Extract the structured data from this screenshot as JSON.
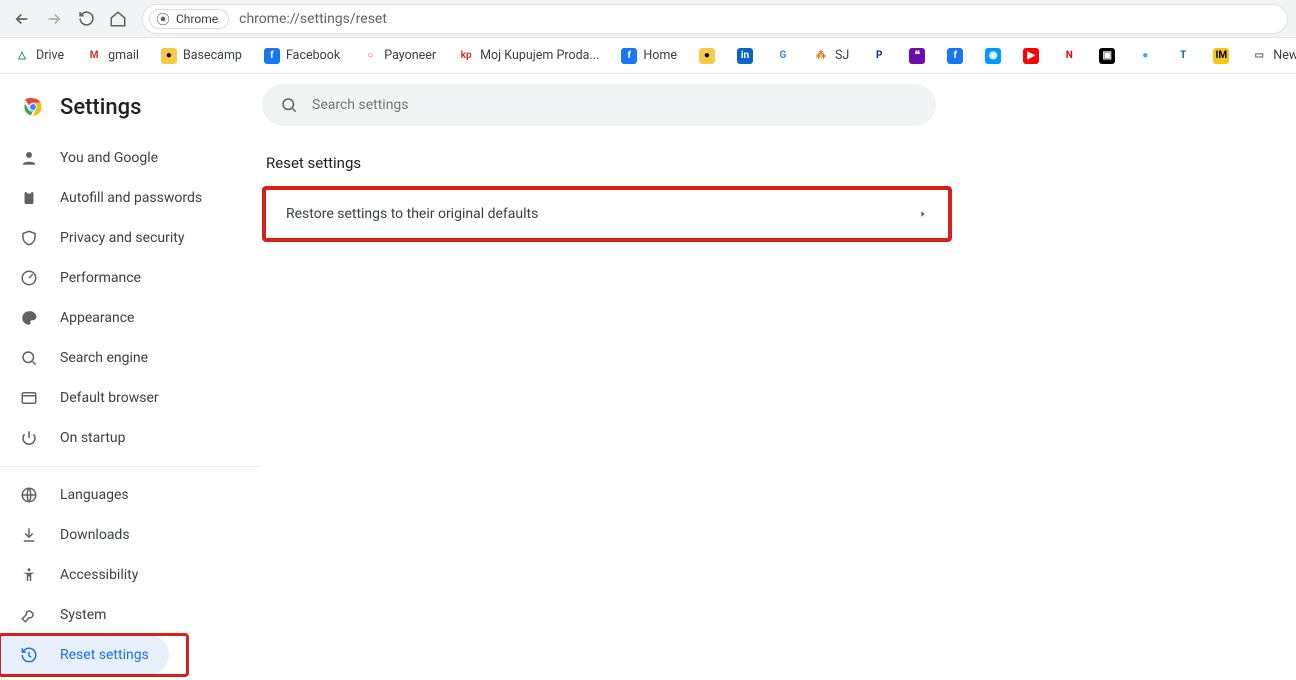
{
  "toolbar": {
    "chip_label": "Chrome",
    "url": "chrome://settings/reset"
  },
  "bookmarks": [
    {
      "label": "Drive",
      "bg": "#fff",
      "fg": "#0f9d58",
      "txt": "△"
    },
    {
      "label": "gmail",
      "bg": "#fff",
      "fg": "#d93025",
      "txt": "M"
    },
    {
      "label": "Basecamp",
      "bg": "#f7c948",
      "fg": "#000",
      "txt": "●"
    },
    {
      "label": "Facebook",
      "bg": "#1877f2",
      "fg": "#fff",
      "txt": "f"
    },
    {
      "label": "Payoneer",
      "bg": "#fff",
      "fg": "#ff4800",
      "txt": "○"
    },
    {
      "label": "Moj Kupujem Proda...",
      "bg": "#fff",
      "fg": "#d3302f",
      "txt": "kp"
    },
    {
      "label": "Home",
      "bg": "#1877f2",
      "fg": "#fff",
      "txt": "f"
    },
    {
      "label": "",
      "bg": "#f7c948",
      "fg": "#000",
      "txt": "●"
    },
    {
      "label": "",
      "bg": "#0a66c2",
      "fg": "#fff",
      "txt": "in"
    },
    {
      "label": "",
      "bg": "#fff",
      "fg": "#4285f4",
      "txt": "G"
    },
    {
      "label": "SJ",
      "bg": "#fff",
      "fg": "#e8710a",
      "txt": "⁂"
    },
    {
      "label": "",
      "bg": "#fff",
      "fg": "#003087",
      "txt": "P"
    },
    {
      "label": "",
      "bg": "#6a0dad",
      "fg": "#fff",
      "txt": "❝"
    },
    {
      "label": "",
      "bg": "#1877f2",
      "fg": "#fff",
      "txt": "f"
    },
    {
      "label": "",
      "bg": "#0099ff",
      "fg": "#fff",
      "txt": "◉"
    },
    {
      "label": "",
      "bg": "#ff0000",
      "fg": "#fff",
      "txt": "▶"
    },
    {
      "label": "",
      "bg": "#fff",
      "fg": "#e50914",
      "txt": "N"
    },
    {
      "label": "",
      "bg": "#000",
      "fg": "#fff",
      "txt": "▣"
    },
    {
      "label": "",
      "bg": "#fff",
      "fg": "#3aa3ff",
      "txt": "●"
    },
    {
      "label": "",
      "bg": "#fff",
      "fg": "#006b8f",
      "txt": "T"
    },
    {
      "label": "",
      "bg": "#f5c518",
      "fg": "#000",
      "txt": "IM"
    },
    {
      "label": "New folder",
      "bg": "#fff",
      "fg": "#5f6368",
      "txt": "▭"
    }
  ],
  "brand": {
    "title": "Settings"
  },
  "nav": [
    {
      "label": "You and Google",
      "icon": "person"
    },
    {
      "label": "Autofill and passwords",
      "icon": "clipboard"
    },
    {
      "label": "Privacy and security",
      "icon": "shield"
    },
    {
      "label": "Performance",
      "icon": "speed"
    },
    {
      "label": "Appearance",
      "icon": "palette"
    },
    {
      "label": "Search engine",
      "icon": "search"
    },
    {
      "label": "Default browser",
      "icon": "browser"
    },
    {
      "label": "On startup",
      "icon": "power"
    }
  ],
  "nav2": [
    {
      "label": "Languages",
      "icon": "globe"
    },
    {
      "label": "Downloads",
      "icon": "download"
    },
    {
      "label": "Accessibility",
      "icon": "accessibility"
    },
    {
      "label": "System",
      "icon": "wrench"
    },
    {
      "label": "Reset settings",
      "icon": "history",
      "active": true
    }
  ],
  "search": {
    "placeholder": "Search settings"
  },
  "section": {
    "title": "Reset settings"
  },
  "card": {
    "row_label": "Restore settings to their original defaults"
  }
}
